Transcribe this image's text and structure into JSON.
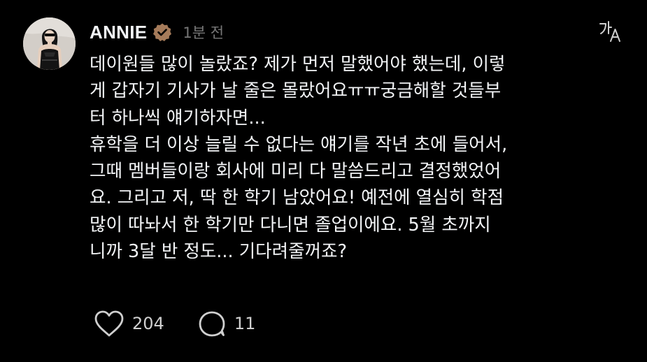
{
  "post": {
    "username": "ANNIE",
    "timestamp": "1분 전",
    "verified_color": "#a57b5a",
    "translate_icon": "translate-icon",
    "body_lines": [
      "데이원들 많이 놀랐죠? 제가 먼저 말했어야 했는데, 이렇",
      "게 갑자기 기사가 날 줄은 몰랐어요ㅠㅠ궁금해할 것들부",
      "터 하나씩 얘기하자면...",
      "휴학을 더 이상 늘릴 수 없다는 얘기를 작년 초에 들어서,",
      "그때 멤버들이랑 회사에 미리 다 말씀드리고 결정했었어",
      "요. 그리고 저, 딱 한 학기 남았어요! 예전에 열심히 학점",
      "많이 따놔서 한 학기만 다니면 졸업이에요. 5월 초까지",
      "니까 3달 반 정도... 기다려줄꺼죠?"
    ],
    "like_count": "204",
    "reply_count": "11"
  }
}
